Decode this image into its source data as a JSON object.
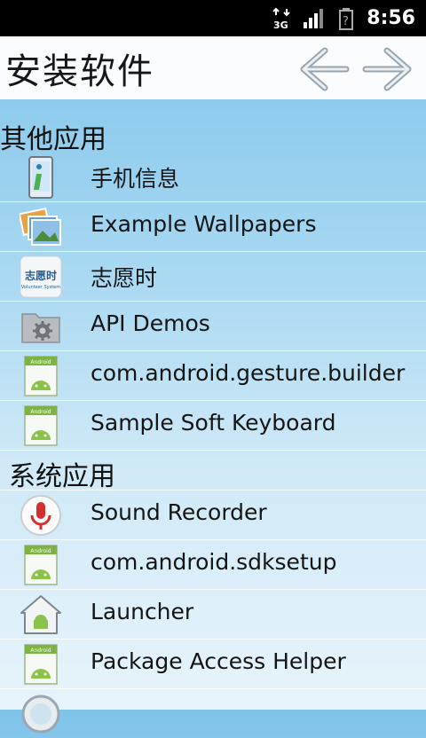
{
  "status": {
    "time": "8:56",
    "network": "3G"
  },
  "header": {
    "title": "安装软件"
  },
  "sections": [
    {
      "title": "其他应用",
      "apps": [
        {
          "label": "手机信息",
          "icon": "phone-info-icon"
        },
        {
          "label": "Example Wallpapers",
          "icon": "wallpapers-icon"
        },
        {
          "label": "志愿时",
          "icon": "volunteer-icon"
        },
        {
          "label": "API Demos",
          "icon": "settings-folder-icon"
        },
        {
          "label": "com.android.gesture.builder",
          "icon": "android-package-icon"
        },
        {
          "label": "Sample Soft Keyboard",
          "icon": "android-package-icon"
        }
      ]
    },
    {
      "title": "系统应用",
      "apps": [
        {
          "label": "Sound Recorder",
          "icon": "microphone-icon"
        },
        {
          "label": "com.android.sdksetup",
          "icon": "android-package-icon"
        },
        {
          "label": "Launcher",
          "icon": "home-android-icon"
        },
        {
          "label": "Package Access Helper",
          "icon": "android-package-icon"
        },
        {
          "label": "",
          "icon": "search-icon"
        }
      ]
    }
  ],
  "volunteer_icon_text": {
    "main": "志愿时",
    "sub": "Volunteer System"
  },
  "android_badge_text": "Android"
}
